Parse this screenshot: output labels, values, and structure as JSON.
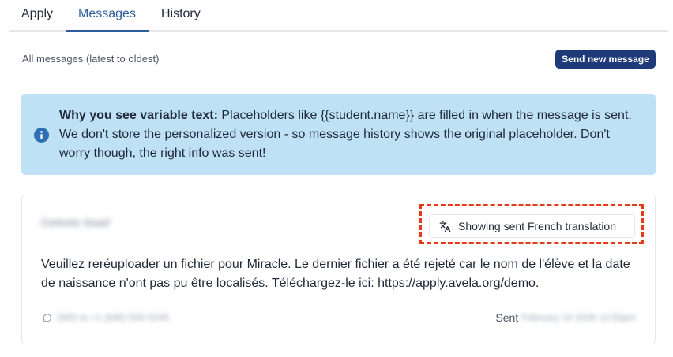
{
  "tabs": [
    {
      "label": "Apply",
      "active": false
    },
    {
      "label": "Messages",
      "active": true
    },
    {
      "label": "History",
      "active": false
    }
  ],
  "header": {
    "subtitle": "All messages (latest to oldest)",
    "send_button": "Send new message"
  },
  "info_banner": {
    "title": "Why you see variable text:",
    "text": " Placeholders like {{student.name}} are filled in when the message is sent. We don't store the personalized version - so message history shows the original placeholder. Don't worry though, the right info was sent!",
    "icon": "info-icon"
  },
  "message": {
    "sender": "Celeste Saad",
    "translation_label": "Showing sent French translation",
    "body": "Veuillez reréuploader un fichier pour Miracle. Le dernier fichier a été rejeté car le nom de l'élève et la date de naissance n'ont pas pu être localisés. Téléchargez-le ici: https://apply.avela.org/demo.",
    "channel": "SMS to +1 (646) 555-0245",
    "sent_label": "Sent",
    "sent_date": "February 10 2026 12:50pm"
  },
  "colors": {
    "accent": "#2f5d9a",
    "button": "#1e3a78",
    "banner_bg": "#bfe1f6",
    "highlight": "#e63a17"
  }
}
